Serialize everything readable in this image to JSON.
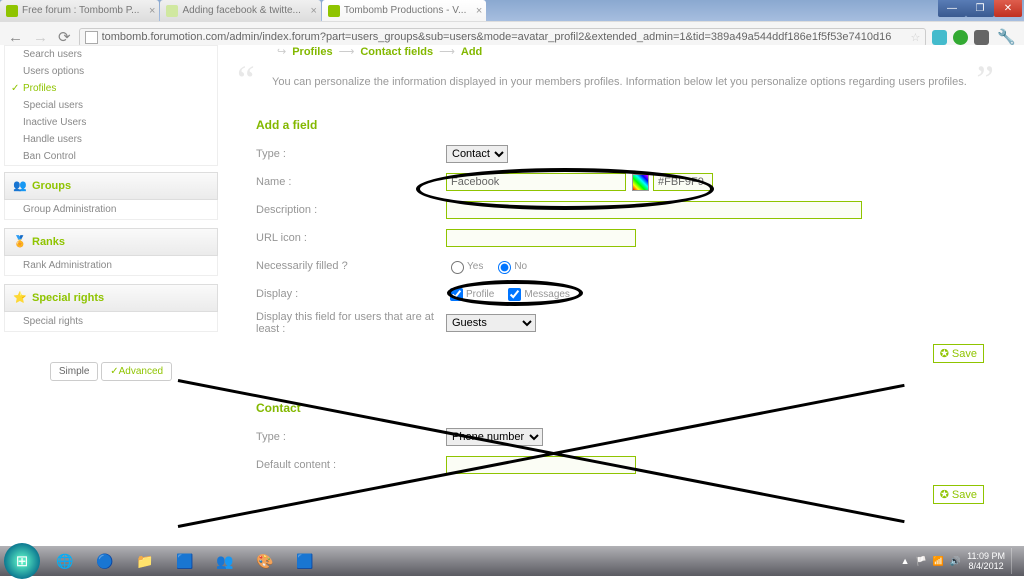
{
  "browser_tabs": [
    {
      "icon": "green",
      "title": "Free forum : Tombomb P..."
    },
    {
      "icon": "fm",
      "title": "Adding facebook & twitte..."
    },
    {
      "icon": "green",
      "title": "Tombomb Productions - V..."
    }
  ],
  "url": "tombomb.forumotion.com/admin/index.forum?part=users_groups&sub=users&mode=avatar_profil2&extended_admin=1&tid=389a49a544ddf186e1f5f53e7410d16",
  "sidebar": {
    "users_items": [
      "Search users",
      "Users options",
      "Profiles",
      "Special users",
      "Inactive Users",
      "Handle users",
      "Ban Control"
    ],
    "groups_head": "Groups",
    "groups_item": "Group Administration",
    "ranks_head": "Ranks",
    "ranks_item": "Rank Administration",
    "rights_head": "Special rights",
    "rights_item": "Special rights",
    "simple": "Simple",
    "advanced": "Advanced"
  },
  "breadcrumb": {
    "a": "Profiles",
    "b": "Contact fields",
    "c": "Add"
  },
  "intro_text": "You can personalize the information displayed in your members profiles. Information below let you personalize options regarding users profiles.",
  "section1_title": "Add a field",
  "labels": {
    "type": "Type :",
    "name": "Name :",
    "desc": "Description :",
    "urlicon": "URL icon :",
    "necess": "Necessarily filled ?",
    "display": "Display :",
    "display_level": "Display this field for users that are at least :",
    "default_content": "Default content :"
  },
  "values": {
    "type_sel": "Contact",
    "name": "Facebook",
    "color": "#FBF9F9",
    "yes": "Yes",
    "no": "No",
    "profile": "Profile",
    "messages": "Messages",
    "guests": "Guests",
    "type2_sel": "Phone number"
  },
  "save": "Save",
  "section2_title": "Contact",
  "clock": {
    "time": "11:09 PM",
    "date": "8/4/2012"
  }
}
